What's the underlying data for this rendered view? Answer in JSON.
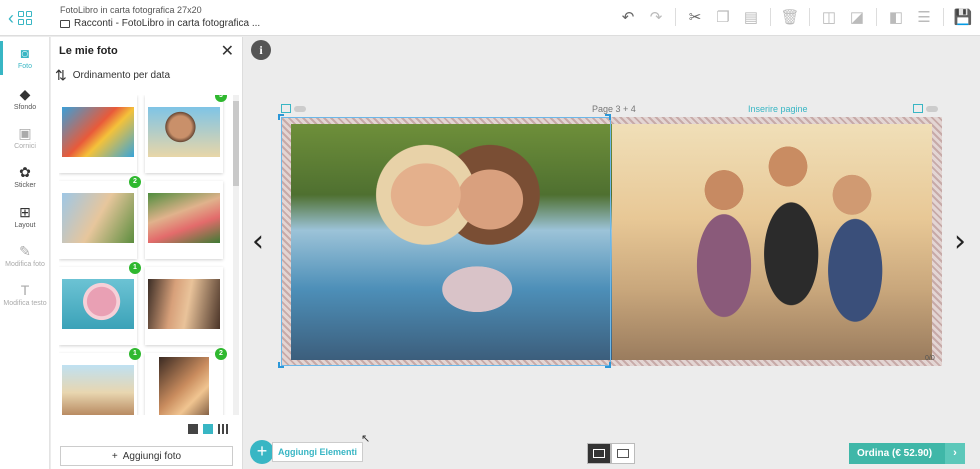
{
  "header": {
    "project_type": "FotoLibro in carta fotografica 27x20",
    "project_name": "Racconti - FotoLibro in carta fotografica ..."
  },
  "toolbar": {
    "icons": [
      "undo-icon",
      "redo-icon",
      "cut-icon",
      "copy-icon",
      "paste-icon",
      "delete-icon",
      "bring-forward-icon",
      "send-backward-icon",
      "mirror-icon",
      "align-icon",
      "save-icon"
    ]
  },
  "nav": {
    "items": [
      {
        "label": "Foto",
        "icon": "camera-icon"
      },
      {
        "label": "Sfondo",
        "icon": "paint-bucket-icon"
      },
      {
        "label": "Cornici",
        "icon": "frame-icon"
      },
      {
        "label": "Sticker",
        "icon": "sticker-icon"
      },
      {
        "label": "Layout",
        "icon": "layout-icon"
      },
      {
        "label": "Modifica foto",
        "icon": "pencil-icon"
      },
      {
        "label": "Modifica testo",
        "icon": "text-icon"
      }
    ]
  },
  "panel": {
    "title": "Le mie foto",
    "sort_label": "Ordinamento per data",
    "badges": [
      "3",
      "2",
      "1",
      "1",
      "2"
    ],
    "add_photo": "Aggiungi foto"
  },
  "canvas": {
    "page_label": "Page 3 + 4",
    "insert_label": "Inserire pagine",
    "page_number": "0/0"
  },
  "footer": {
    "add_elements": "Aggiungi Elementi",
    "order_button": "Ordina (€ 52.90)"
  },
  "colors": {
    "accent": "#38b6c4",
    "order": "#3fb7a8",
    "badge": "#2fb82f"
  }
}
